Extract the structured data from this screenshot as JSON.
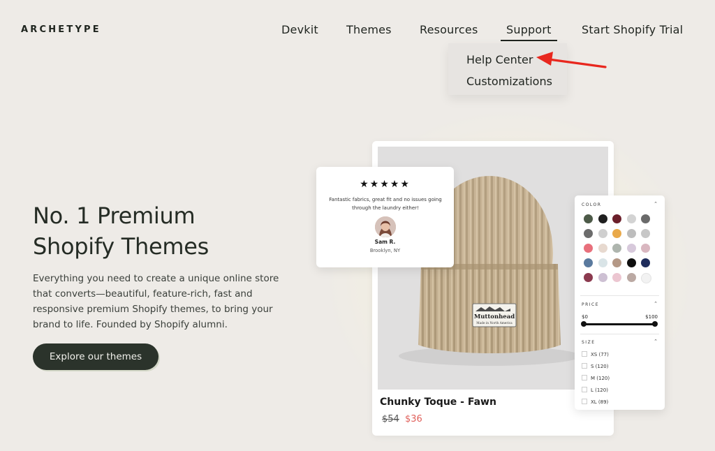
{
  "brand": {
    "logo": "ARCHETYPE"
  },
  "nav": {
    "devkit": "Devkit",
    "themes": "Themes",
    "resources": "Resources",
    "support": "Support",
    "trial": "Start Shopify Trial"
  },
  "support_menu": {
    "help_center": "Help Center",
    "customizations": "Customizations"
  },
  "hero": {
    "title_line1": "No. 1 Premium",
    "title_line2": "Shopify Themes",
    "subtitle": "Everything you need to create a unique online store that converts—beautiful, feature-rich, fast and responsive premium Shopify themes, to bring your brand to life. Founded by Shopify alumni.",
    "cta": "Explore our themes"
  },
  "review": {
    "stars": "★★★★★",
    "text": "Fantastic fabrics, great fit and no issues going through the laundry either!",
    "name": "Sam R.",
    "location": "Brooklyn, NY"
  },
  "product": {
    "name": "Chunky Toque - Fawn",
    "price_old": "$54",
    "price_new": "$36",
    "label_brand": "Muttonhead",
    "label_sub": "Made in North America"
  },
  "filters": {
    "color_label": "COLOR",
    "price_label": "PRICE",
    "size_label": "SIZE",
    "price_min": "$0",
    "price_max": "$100",
    "swatches": [
      [
        "#4d5a48",
        "#1f1f1f",
        "#6b1f2b",
        "#d3d3d3",
        "#6a6a6a"
      ],
      [
        "#6c6c6c",
        "#cfcfcf",
        "#e9a94a",
        "#bdbdbd",
        "#c7c7c7"
      ],
      [
        "#e8707c",
        "#e7d9cf",
        "#aeb5ae",
        "#d7c9db",
        "#d9b7c0"
      ],
      [
        "#5a7a9e",
        "#d9e4e7",
        "#b49886",
        "#0f0f0f",
        "#1f2d5c"
      ],
      [
        "#8b3a4f",
        "#cdc0d3",
        "#ecc6d1",
        "#bba9a3",
        "#f2f2f2"
      ]
    ],
    "sizes": [
      "XS (77)",
      "S (120)",
      "M (120)",
      "L (120)",
      "XL (89)"
    ]
  },
  "colors": {
    "accent": "#2b332b",
    "sale": "#e0605b",
    "annotation_arrow": "#e8271e"
  }
}
